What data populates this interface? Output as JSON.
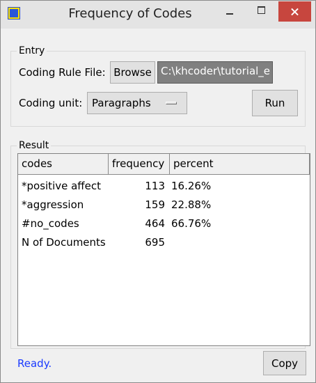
{
  "window": {
    "title": "Frequency of Codes"
  },
  "entry": {
    "group_label": "Entry",
    "coding_rule_label": "Coding Rule File:",
    "browse_label": "Browse",
    "file_path": "C:\\khcoder\\tutorial_e",
    "coding_unit_label": "Coding unit:",
    "coding_unit_value": "Paragraphs",
    "run_label": "Run"
  },
  "result": {
    "group_label": "Result",
    "columns": [
      "codes",
      "frequency",
      "percent"
    ],
    "rows": [
      {
        "code": "*positive affect",
        "frequency": "113",
        "percent": "16.26%"
      },
      {
        "code": "*aggression",
        "frequency": "159",
        "percent": "22.88%"
      },
      {
        "code": "#no_codes",
        "frequency": "464",
        "percent": "66.76%"
      },
      {
        "code": "N of Documents",
        "frequency": "695",
        "percent": ""
      }
    ]
  },
  "status": {
    "text": "Ready.",
    "color": "#1a3aff"
  },
  "footer": {
    "copy_label": "Copy"
  }
}
